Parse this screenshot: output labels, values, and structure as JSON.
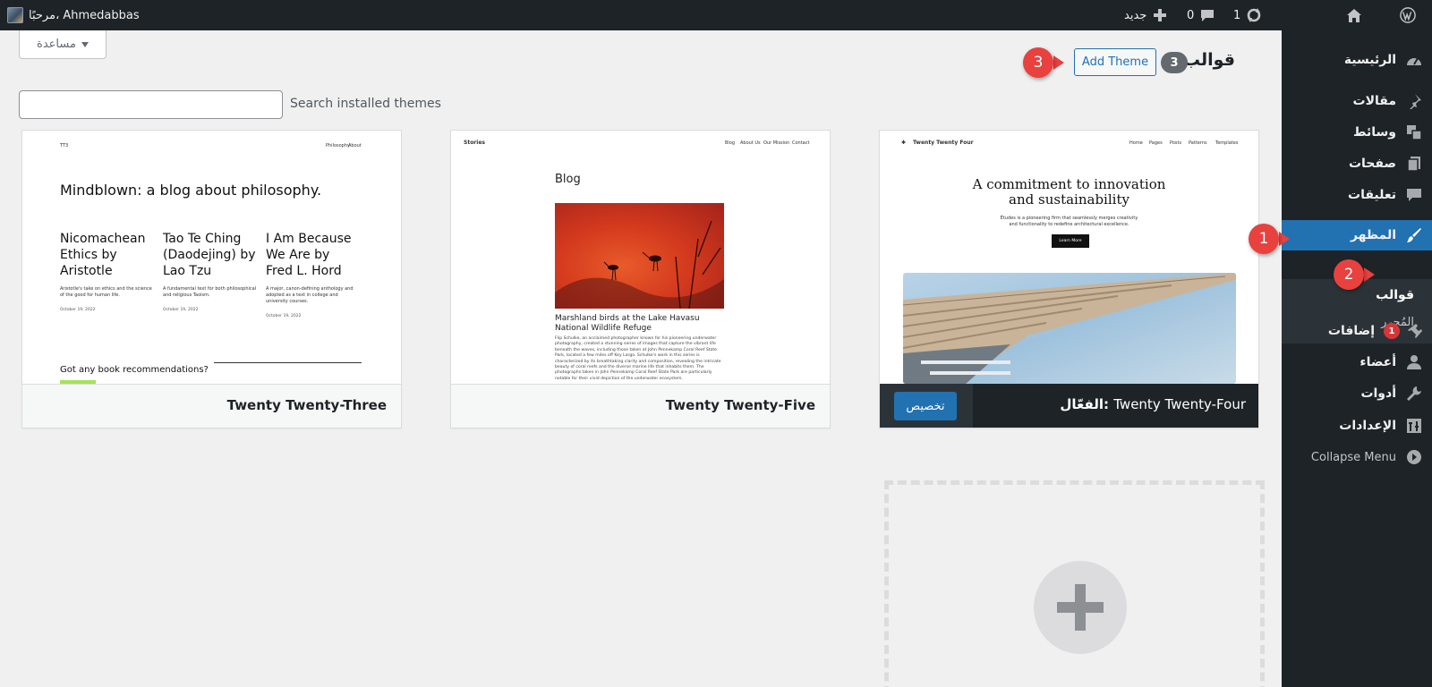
{
  "admin_bar": {
    "greeting": "مرحبًا، Ahmedabbas",
    "new_label": "جديد",
    "comments_count": "0",
    "updates_count": "1"
  },
  "sidebar": {
    "items": [
      {
        "label": "الرئيسية",
        "icon": "dashboard-icon"
      },
      {
        "label": "مقالات",
        "icon": "pin-icon"
      },
      {
        "label": "وسائط",
        "icon": "media-icon"
      },
      {
        "label": "صفحات",
        "icon": "pages-icon"
      },
      {
        "label": "تعليقات",
        "icon": "comment-icon"
      },
      {
        "label": "المظهر",
        "icon": "brush-icon"
      },
      {
        "label": "إضافات",
        "icon": "plugin-icon",
        "badge": "1"
      },
      {
        "label": "أعضاء",
        "icon": "users-icon"
      },
      {
        "label": "أدوات",
        "icon": "wrench-icon"
      },
      {
        "label": "الإعدادات",
        "icon": "settings-icon"
      }
    ],
    "appearance_submenu": [
      "قوالب",
      "المُحرر"
    ],
    "collapse_label": "Collapse Menu"
  },
  "markers": [
    "1",
    "2",
    "3"
  ],
  "header": {
    "help_label": "مساعدة",
    "title": "قوالب",
    "count": "3",
    "add_theme_label": "Add Theme"
  },
  "search": {
    "label": "Search installed themes",
    "value": ""
  },
  "themes": [
    {
      "name": "Twenty Twenty-Three",
      "shot": {
        "brand": "TT3",
        "nav": [
          "Philosophy",
          "About"
        ],
        "headline": "Mindblown: a blog about philosophy.",
        "posts": [
          {
            "title": "Nicomachean Ethics by Aristotle",
            "desc": "Aristotle's take on ethics and the science of the good for human life.",
            "date": "October 19, 2022"
          },
          {
            "title": "Tao Te Ching (Daodejing) by Lao Tzu",
            "desc": "A fundamental text for both philosophical and religious Taoism.",
            "date": "October 19, 2022"
          },
          {
            "title": "I Am Because We Are by Fred L. Hord",
            "desc": "A major, canon-defining anthology and adopted as a text in college and university courses.",
            "date": "October 19, 2022"
          }
        ],
        "footer_q": "Got any book recommendations?"
      }
    },
    {
      "name": "Twenty Twenty-Five",
      "shot": {
        "brand": "Stories",
        "nav": [
          "Blog",
          "About Us",
          "Our Mission",
          "Contact"
        ],
        "heading": "Blog",
        "caption": "Marshland birds at the Lake Havasu National Wildlife Refuge",
        "body": "Flip Schulke, an acclaimed photographer known for his pioneering underwater photography, created a stunning series of images that capture the vibrant life beneath the waves, including those taken at John Pennekamp Coral Reef State Park, located a few miles off Key Largo. Schulke's work in this series is characterized by its breathtaking clarity and composition, revealing the intricate beauty of coral reefs and the diverse marine life that inhabits them. The photographs taken in John Pennekamp Coral Reef State Park are particularly notable for their vivid depiction of the underwater ecosystem."
      }
    },
    {
      "name": "Twenty Twenty-Four",
      "active_prefix": "الفعّال:",
      "customize_label": "تخصيص",
      "shot": {
        "brand": "Twenty Twenty Four",
        "nav": [
          "Home",
          "Pages",
          "Posts",
          "Patterns",
          "Templates"
        ],
        "headline_1": "A commitment to innovation",
        "headline_2": "and sustainability",
        "sub_1": "Études is a pioneering firm that seamlessly merges creativity",
        "sub_2": "and functionality to redefine architectural excellence.",
        "button": "Learn More"
      }
    }
  ],
  "colors": {
    "admin_dark": "#1d2327",
    "accent_blue": "#2271b1",
    "marker_red": "#e8413e",
    "page_bg": "#f0f0f1"
  }
}
